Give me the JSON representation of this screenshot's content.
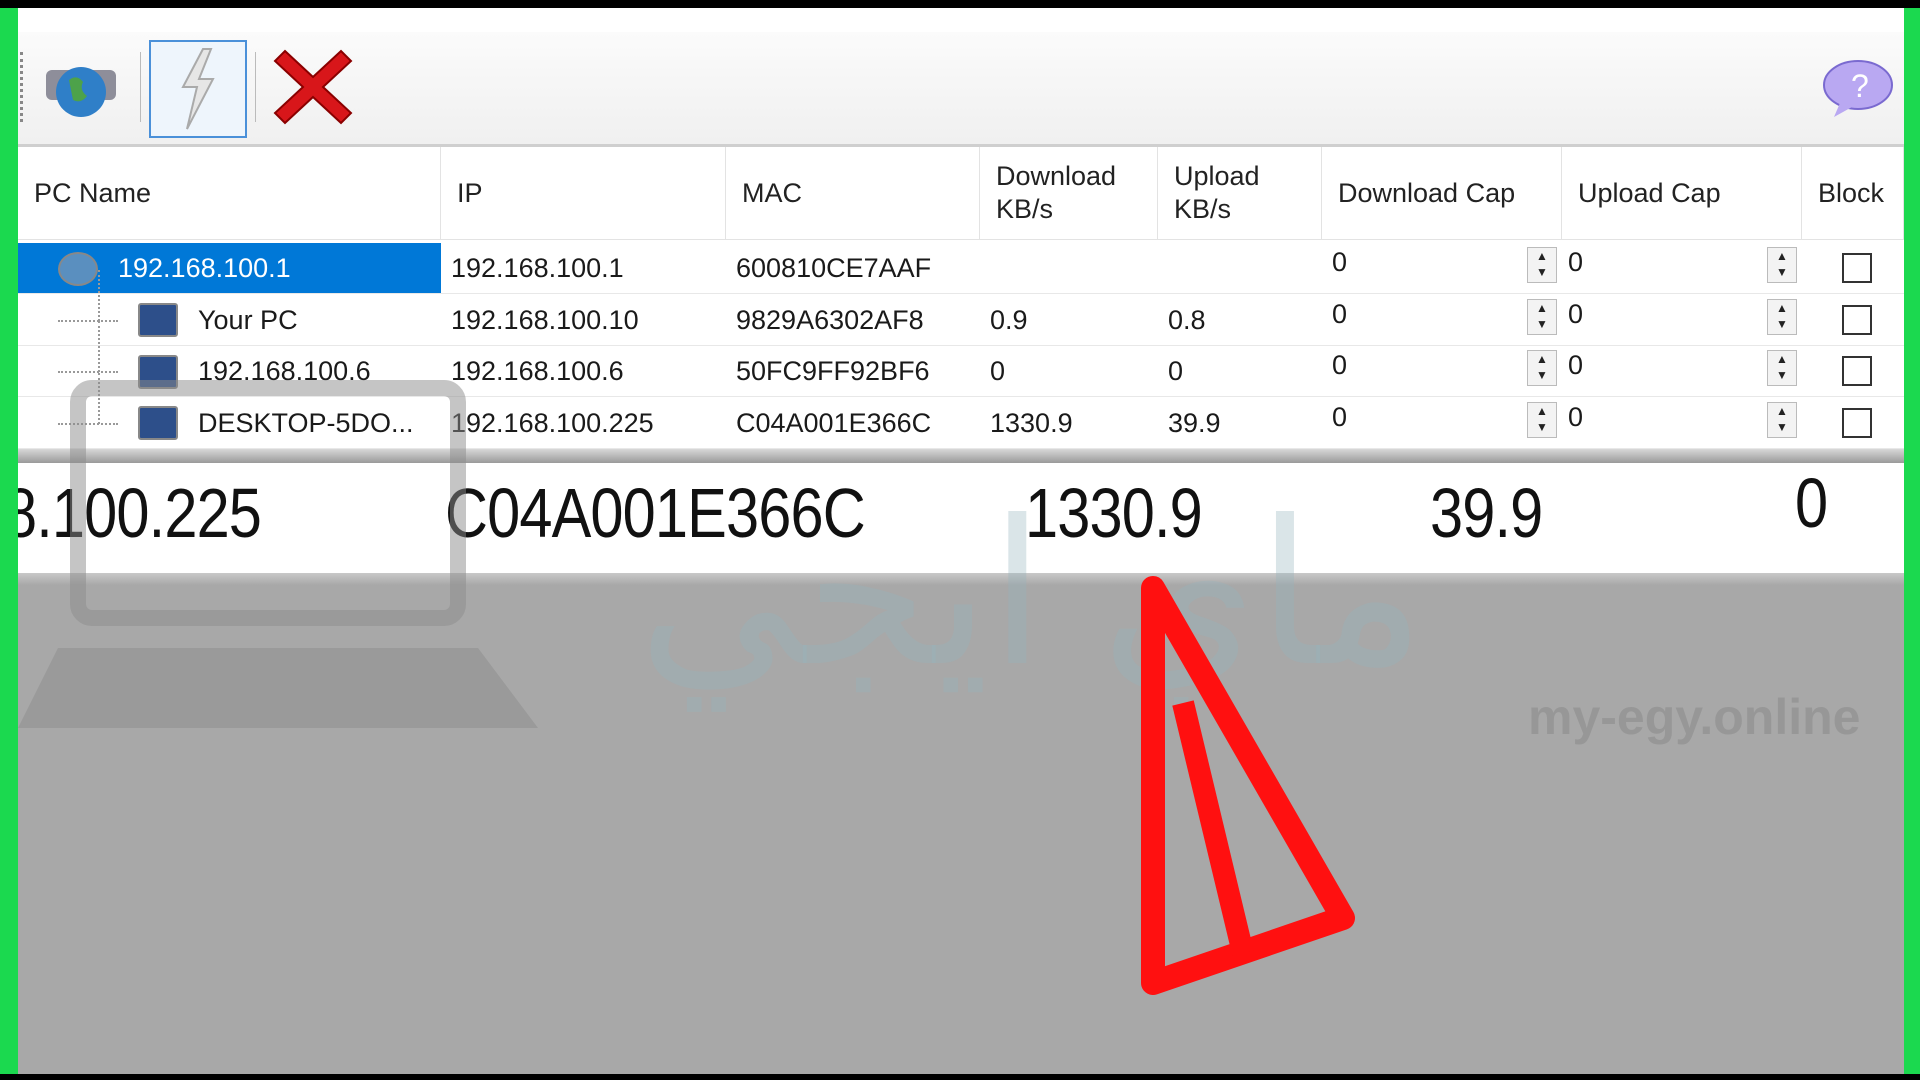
{
  "toolbar": {
    "buttons": [
      {
        "name": "scan-network",
        "icon": "globe-network-icon"
      },
      {
        "name": "start",
        "icon": "lightning-icon",
        "selected": true
      },
      {
        "name": "stop",
        "icon": "red-x-icon"
      }
    ],
    "help_icon": "help-bubble-icon"
  },
  "columns": [
    "PC Name",
    "IP",
    "MAC",
    "Download\nKB/s",
    "Upload\nKB/s",
    "Download Cap",
    "Upload Cap",
    "Block"
  ],
  "rows": [
    {
      "name": "192.168.100.1",
      "ip": "192.168.100.1",
      "mac": "600810CE7AAF",
      "dl": "",
      "ul": "",
      "dlcap": "0",
      "ulcap": "0",
      "blocked": false,
      "selected": true,
      "icon": "router-icon"
    },
    {
      "name": "Your PC",
      "ip": "192.168.100.10",
      "mac": "9829A6302AF8",
      "dl": "0.9",
      "ul": "0.8",
      "dlcap": "0",
      "ulcap": "0",
      "blocked": false,
      "icon": "computer-icon"
    },
    {
      "name": "192.168.100.6",
      "ip": "192.168.100.6",
      "mac": "50FC9FF92BF6",
      "dl": "0",
      "ul": "0",
      "dlcap": "0",
      "ulcap": "0",
      "blocked": false,
      "icon": "computer-icon"
    },
    {
      "name": "DESKTOP-5DO...",
      "ip": "192.168.100.225",
      "mac": "C04A001E366C",
      "dl": "1330.9",
      "ul": "39.9",
      "dlcap": "0",
      "ulcap": "0",
      "blocked": false,
      "icon": "computer-icon"
    }
  ],
  "magnified": {
    "ip": "8.100.225",
    "mac": "C04A001E366C",
    "dl": "1330.9",
    "ul": "39.9",
    "cap": "0"
  },
  "watermark": {
    "arabic": "ماي ايجي",
    "latin": "my-egy.online"
  },
  "colors": {
    "selection": "#0078d7",
    "frame": "#1bd94f",
    "arrow": "#ff1010"
  }
}
